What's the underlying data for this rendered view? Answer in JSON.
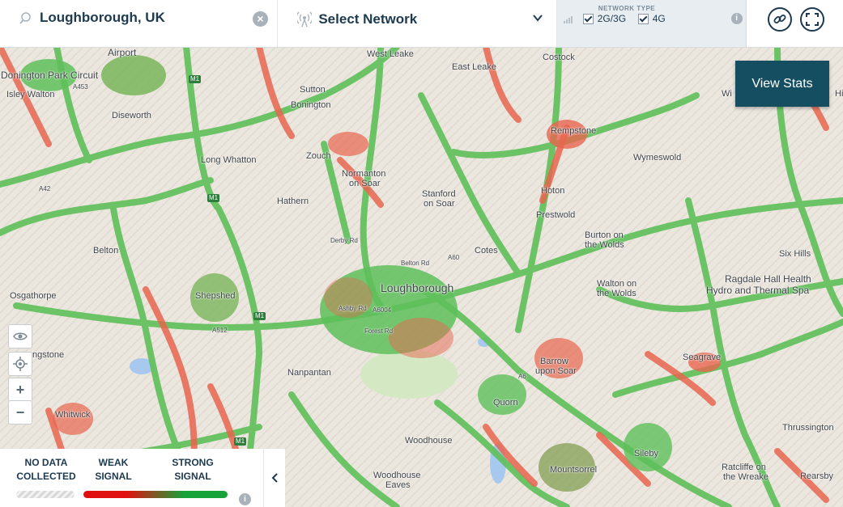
{
  "search": {
    "value": "Loughborough, UK",
    "icon": "search-icon",
    "clear_icon": "close-circle-icon"
  },
  "network": {
    "label": "Select Network",
    "icon": "antenna-icon",
    "dropdown_icon": "chevron-down-icon"
  },
  "network_type": {
    "title": "NETWORK TYPE",
    "options": [
      {
        "label": "2G/3G",
        "checked": true
      },
      {
        "label": "4G",
        "checked": true
      }
    ],
    "info": "i"
  },
  "tools": {
    "link_icon": "link-icon",
    "fullscreen_icon": "fullscreen-icon"
  },
  "map": {
    "view_stats": "View Stats",
    "zoom_in": "+",
    "zoom_out": "−",
    "places": {
      "airport": "Airport",
      "donington": "Donington Park Circuit",
      "isley": "Isley Walton",
      "diseworth": "Diseworth",
      "west_leake": "West Leake",
      "costock": "Costock",
      "east_leake": "East Leake",
      "sutton_bonington_1": "Sutton",
      "sutton_bonington_2": "Bonington",
      "rempstone": "Rempstone",
      "wymeswold": "Wymeswold",
      "zouch": "Zouch",
      "long_whatton": "Long Whatton",
      "normanton_1": "Normanton",
      "normanton_2": "on Soar",
      "stanford_1": "Stanford",
      "stanford_2": "on Soar",
      "hoton": "Hoton",
      "prestwold": "Prestwold",
      "hathern": "Hathern",
      "belton": "Belton",
      "burton_1": "Burton on",
      "burton_2": "the Wolds",
      "cotes": "Cotes",
      "six_hills": "Six Hills",
      "loughborough": "Loughborough",
      "ragdale_1": "Ragdale Hall Health",
      "ragdale_2": "Hydro and Thermal Spa",
      "osgathorpe": "Osgathorpe",
      "shepshed": "Shepshed",
      "walton_1": "Walton on",
      "walton_2": "the Wolds",
      "coleorton": "ngstone",
      "barrow_1": "Barrow",
      "barrow_2": "upon Soar",
      "seagrave": "Seagrave",
      "nanpantan": "Nanpantan",
      "quorn": "Quorn",
      "whitwick": "Whitwick",
      "woodhouse": "Woodhouse",
      "woodhouse_eaves_1": "Woodhouse",
      "woodhouse_eaves_2": "Eaves",
      "mountsorrel": "Mountsorrel",
      "sileby": "Sileby",
      "thrussington": "Thrussington",
      "ratcliffe_1": "Ratcliffe on",
      "ratcliffe_2": "the Wreake",
      "rearsby": "Rearsby",
      "wi": "Wi",
      "hi": "Hi"
    },
    "roads": {
      "m1_a": "M1",
      "m1_b": "M1",
      "m1_c": "M1",
      "m1_d": "M1",
      "a453": "A453",
      "a6": "A6",
      "a42": "A42",
      "a512": "A512",
      "a60": "A60",
      "a6004": "A6004",
      "derby_rd": "Derby Rd",
      "belton_rd": "Belton Rd",
      "ashby_rd": "Ashby Rd",
      "forest_rd": "Forest Rd"
    }
  },
  "legend": {
    "no_data": [
      "NO DATA",
      "COLLECTED"
    ],
    "weak": [
      "WEAK",
      "SIGNAL"
    ],
    "strong": [
      "STRONG",
      "SIGNAL"
    ],
    "info": "i",
    "colors": {
      "weak": "#e01010",
      "strong": "#17a33a",
      "accent": "#154d61"
    }
  }
}
